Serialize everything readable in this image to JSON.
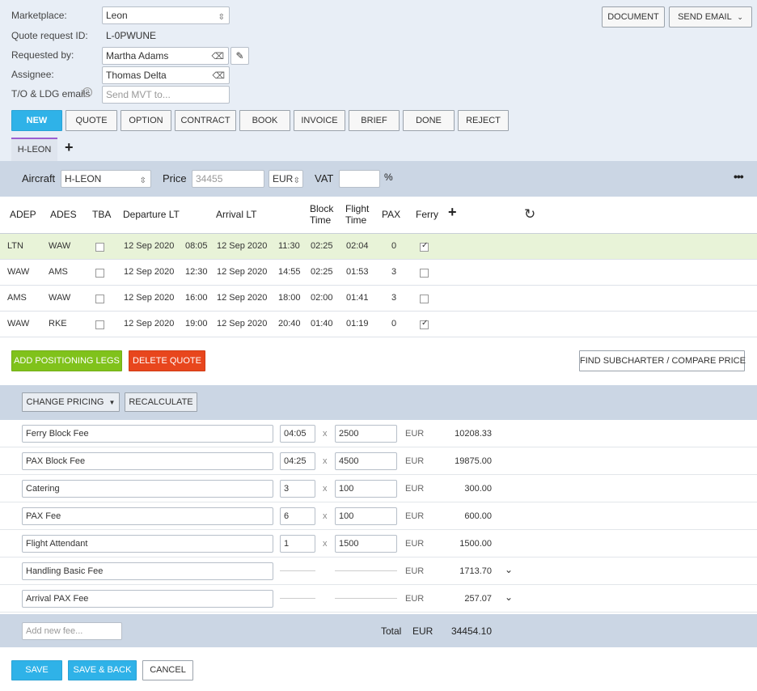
{
  "header": {
    "marketplace_label": "Marketplace:",
    "marketplace_value": "Leon",
    "quote_id_label": "Quote request ID:",
    "quote_id_value": "L-0PWUNE",
    "requested_by_label": "Requested by:",
    "requested_by_value": "Martha Adams",
    "assignee_label": "Assignee:",
    "assignee_value": "Thomas Delta",
    "emails_label": "T/O & LDG emails",
    "emails_placeholder": "Send MVT to...",
    "document_label": "DOCUMENT",
    "send_email_label": "SEND EMAIL"
  },
  "status_buttons": [
    "NEW",
    "QUOTE",
    "OPTION",
    "CONTRACT",
    "BOOK",
    "INVOICE",
    "BRIEF",
    "DONE",
    "REJECT"
  ],
  "active_status": "NEW",
  "tabs": [
    {
      "label": "H-LEON"
    }
  ],
  "aircraft": {
    "aircraft_label": "Aircraft",
    "aircraft_value": "H-LEON",
    "price_label": "Price",
    "price_placeholder": "34455",
    "currency": "EUR",
    "vat_label": "VAT",
    "vat_unit": "%"
  },
  "legs_table": {
    "headers": {
      "adep": "ADEP",
      "ades": "ADES",
      "tba": "TBA",
      "departure": "Departure LT",
      "arrival": "Arrival LT",
      "block1": "Block",
      "block2": "Time",
      "flight1": "Flight",
      "flight2": "Time",
      "pax": "PAX",
      "ferry": "Ferry"
    },
    "rows": [
      {
        "adep": "LTN",
        "ades": "WAW",
        "tba": false,
        "dep_date": "12 Sep 2020",
        "dep_time": "08:05",
        "arr_date": "12 Sep 2020",
        "arr_time": "11:30",
        "block": "02:25",
        "flight": "02:04",
        "pax": "0",
        "ferry": true,
        "highlight": true
      },
      {
        "adep": "WAW",
        "ades": "AMS",
        "tba": false,
        "dep_date": "12 Sep 2020",
        "dep_time": "12:30",
        "arr_date": "12 Sep 2020",
        "arr_time": "14:55",
        "block": "02:25",
        "flight": "01:53",
        "pax": "3",
        "ferry": false,
        "highlight": false
      },
      {
        "adep": "AMS",
        "ades": "WAW",
        "tba": false,
        "dep_date": "12 Sep 2020",
        "dep_time": "16:00",
        "arr_date": "12 Sep 2020",
        "arr_time": "18:00",
        "block": "02:00",
        "flight": "01:41",
        "pax": "3",
        "ferry": false,
        "highlight": false
      },
      {
        "adep": "WAW",
        "ades": "RKE",
        "tba": false,
        "dep_date": "12 Sep 2020",
        "dep_time": "19:00",
        "arr_date": "12 Sep 2020",
        "arr_time": "20:40",
        "block": "01:40",
        "flight": "01:19",
        "pax": "0",
        "ferry": true,
        "highlight": false
      }
    ]
  },
  "actions": {
    "add_positioning": "ADD POSITIONING LEGS",
    "delete_quote": "DELETE QUOTE",
    "find_subcharter": "FIND SUBCHARTER / COMPARE PRICE"
  },
  "pricing": {
    "change_pricing": "CHANGE PRICING",
    "recalculate": "RECALCULATE",
    "fees": [
      {
        "name": "Ferry Block Fee",
        "qty": "04:05",
        "rate": "2500",
        "currency": "EUR",
        "amount": "10208.33",
        "expandable": false
      },
      {
        "name": "PAX Block Fee",
        "qty": "04:25",
        "rate": "4500",
        "currency": "EUR",
        "amount": "19875.00",
        "expandable": false
      },
      {
        "name": "Catering",
        "qty": "3",
        "rate": "100",
        "currency": "EUR",
        "amount": "300.00",
        "expandable": false
      },
      {
        "name": "PAX Fee",
        "qty": "6",
        "rate": "100",
        "currency": "EUR",
        "amount": "600.00",
        "expandable": false
      },
      {
        "name": "Flight Attendant",
        "qty": "1",
        "rate": "1500",
        "currency": "EUR",
        "amount": "1500.00",
        "expandable": false
      },
      {
        "name": "Handling Basic Fee",
        "qty": "",
        "rate": "",
        "currency": "EUR",
        "amount": "1713.70",
        "expandable": true
      },
      {
        "name": "Arrival PAX Fee",
        "qty": "",
        "rate": "",
        "currency": "EUR",
        "amount": "257.07",
        "expandable": true
      }
    ],
    "multiply_sign": "x",
    "new_fee_placeholder": "Add new fee...",
    "total_label": "Total",
    "total_currency": "EUR",
    "total_value": "34454.10"
  },
  "footer": {
    "save": "SAVE",
    "save_back": "SAVE & BACK",
    "cancel": "CANCEL"
  },
  "colors": {
    "primary": "#2fb2e8",
    "success": "#80c21b",
    "danger": "#e8461d",
    "highlight_row": "#e8f3d8",
    "tab_accent": "#9b5fd1"
  }
}
